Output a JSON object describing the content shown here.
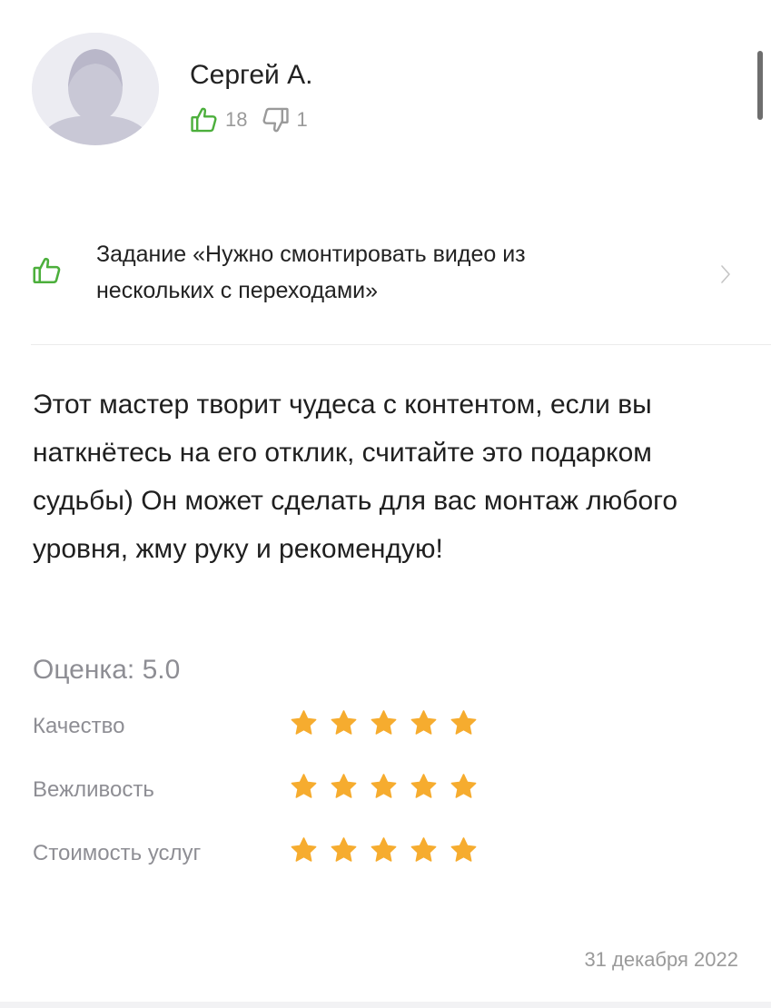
{
  "author": {
    "name": "Сергей А.",
    "likes": "18",
    "dislikes": "1"
  },
  "task": {
    "line1": "Задание «Нужно смонтировать видео из",
    "line2": "нескольких с переходами»"
  },
  "review": {
    "text": "Этот мастер творит чудеса с контентом, если вы наткнётесь на его отклик, считайте это подарком судьбы)  Он может сделать для вас монтаж любого уровня, жму руку и рекомендую!",
    "overall_label": "Оценка: 5.0",
    "criteria": [
      {
        "label": "Качество",
        "stars": 5
      },
      {
        "label": "Вежливость",
        "stars": 5
      },
      {
        "label": "Стоимость услуг",
        "stars": 5
      }
    ],
    "date": "31 декабря 2022"
  },
  "colors": {
    "like_green": "#4caf3c",
    "star_orange": "#f6ac2f",
    "muted_text": "#8e8e94"
  }
}
